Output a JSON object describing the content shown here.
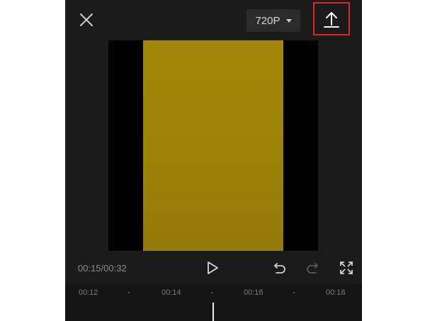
{
  "top_bar": {
    "close_icon": "close-icon",
    "resolution": "720P",
    "export_icon": "upload-icon",
    "highlight_color": "#e1262b"
  },
  "preview": {
    "letterbox_color": "#000000",
    "frame_color": "#9f850a"
  },
  "playback": {
    "time": "00:15/00:32",
    "play_icon": "play-icon",
    "undo_icon": "undo-icon",
    "redo_icon": "redo-icon",
    "fullscreen_icon": "fullscreen-icon"
  },
  "timeline": {
    "ticks": [
      "00:12",
      "00:14",
      "00:16",
      "00:18"
    ]
  }
}
